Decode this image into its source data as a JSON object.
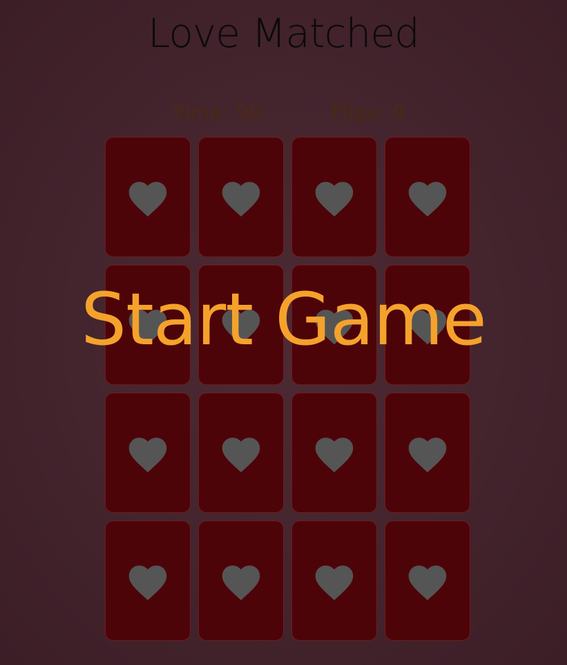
{
  "header": {
    "title": "Love Matched"
  },
  "stats": {
    "time_label": "Time: 90",
    "flips_label": "Flips: 0"
  },
  "board": {
    "card_back_icon": "heart-icon",
    "card_count": 16,
    "columns": 4,
    "rows": 4
  },
  "overlay": {
    "start_label": "Start Game"
  },
  "colors": {
    "background": "#45252e",
    "card_back": "#4d0408",
    "card_border": "#6e1d1f",
    "heart": "#555555",
    "title": "#0a0a0a",
    "stats_text": "#4a2a12",
    "overlay_text": "#f5a22c"
  }
}
